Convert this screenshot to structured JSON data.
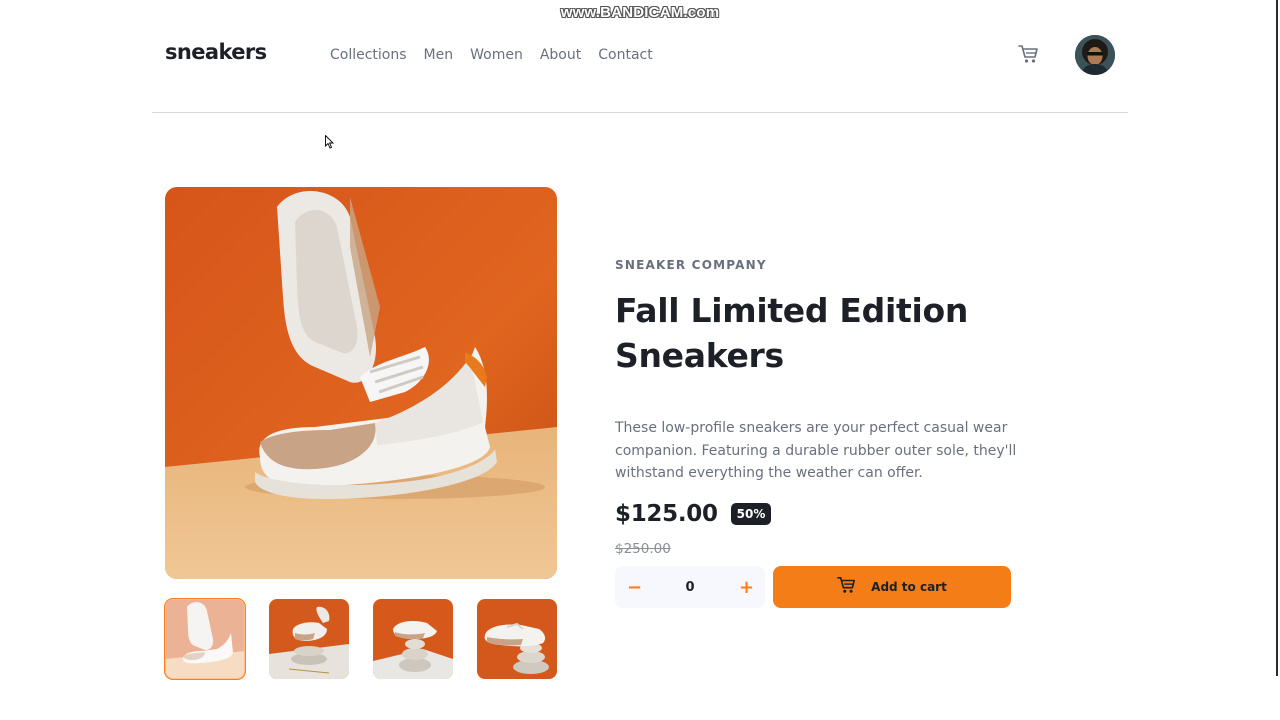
{
  "watermark": "www.BANDICAM.com",
  "header": {
    "logo": "sneakers",
    "nav": [
      "Collections",
      "Men",
      "Women",
      "About",
      "Contact"
    ]
  },
  "product": {
    "company": "SNEAKER COMPANY",
    "title": "Fall Limited Edition Sneakers",
    "description": "These low-profile sneakers are your perfect casual wear companion. Featuring a durable rubber outer sole, they'll withstand everything the weather can offer.",
    "price": "$125.00",
    "discount": "50%",
    "old_price": "$250.00",
    "quantity": "0",
    "decrement_symbol": "−",
    "increment_symbol": "+",
    "add_to_cart_label": "Add to cart",
    "thumbnails_count": 4,
    "active_thumbnail": 1
  },
  "colors": {
    "accent": "#ff7d1a",
    "button": "#f47d17",
    "text_dark": "#1d2026",
    "text_grey": "#69707d"
  },
  "icons": [
    "cart-icon",
    "avatar",
    "mouse-cursor"
  ]
}
